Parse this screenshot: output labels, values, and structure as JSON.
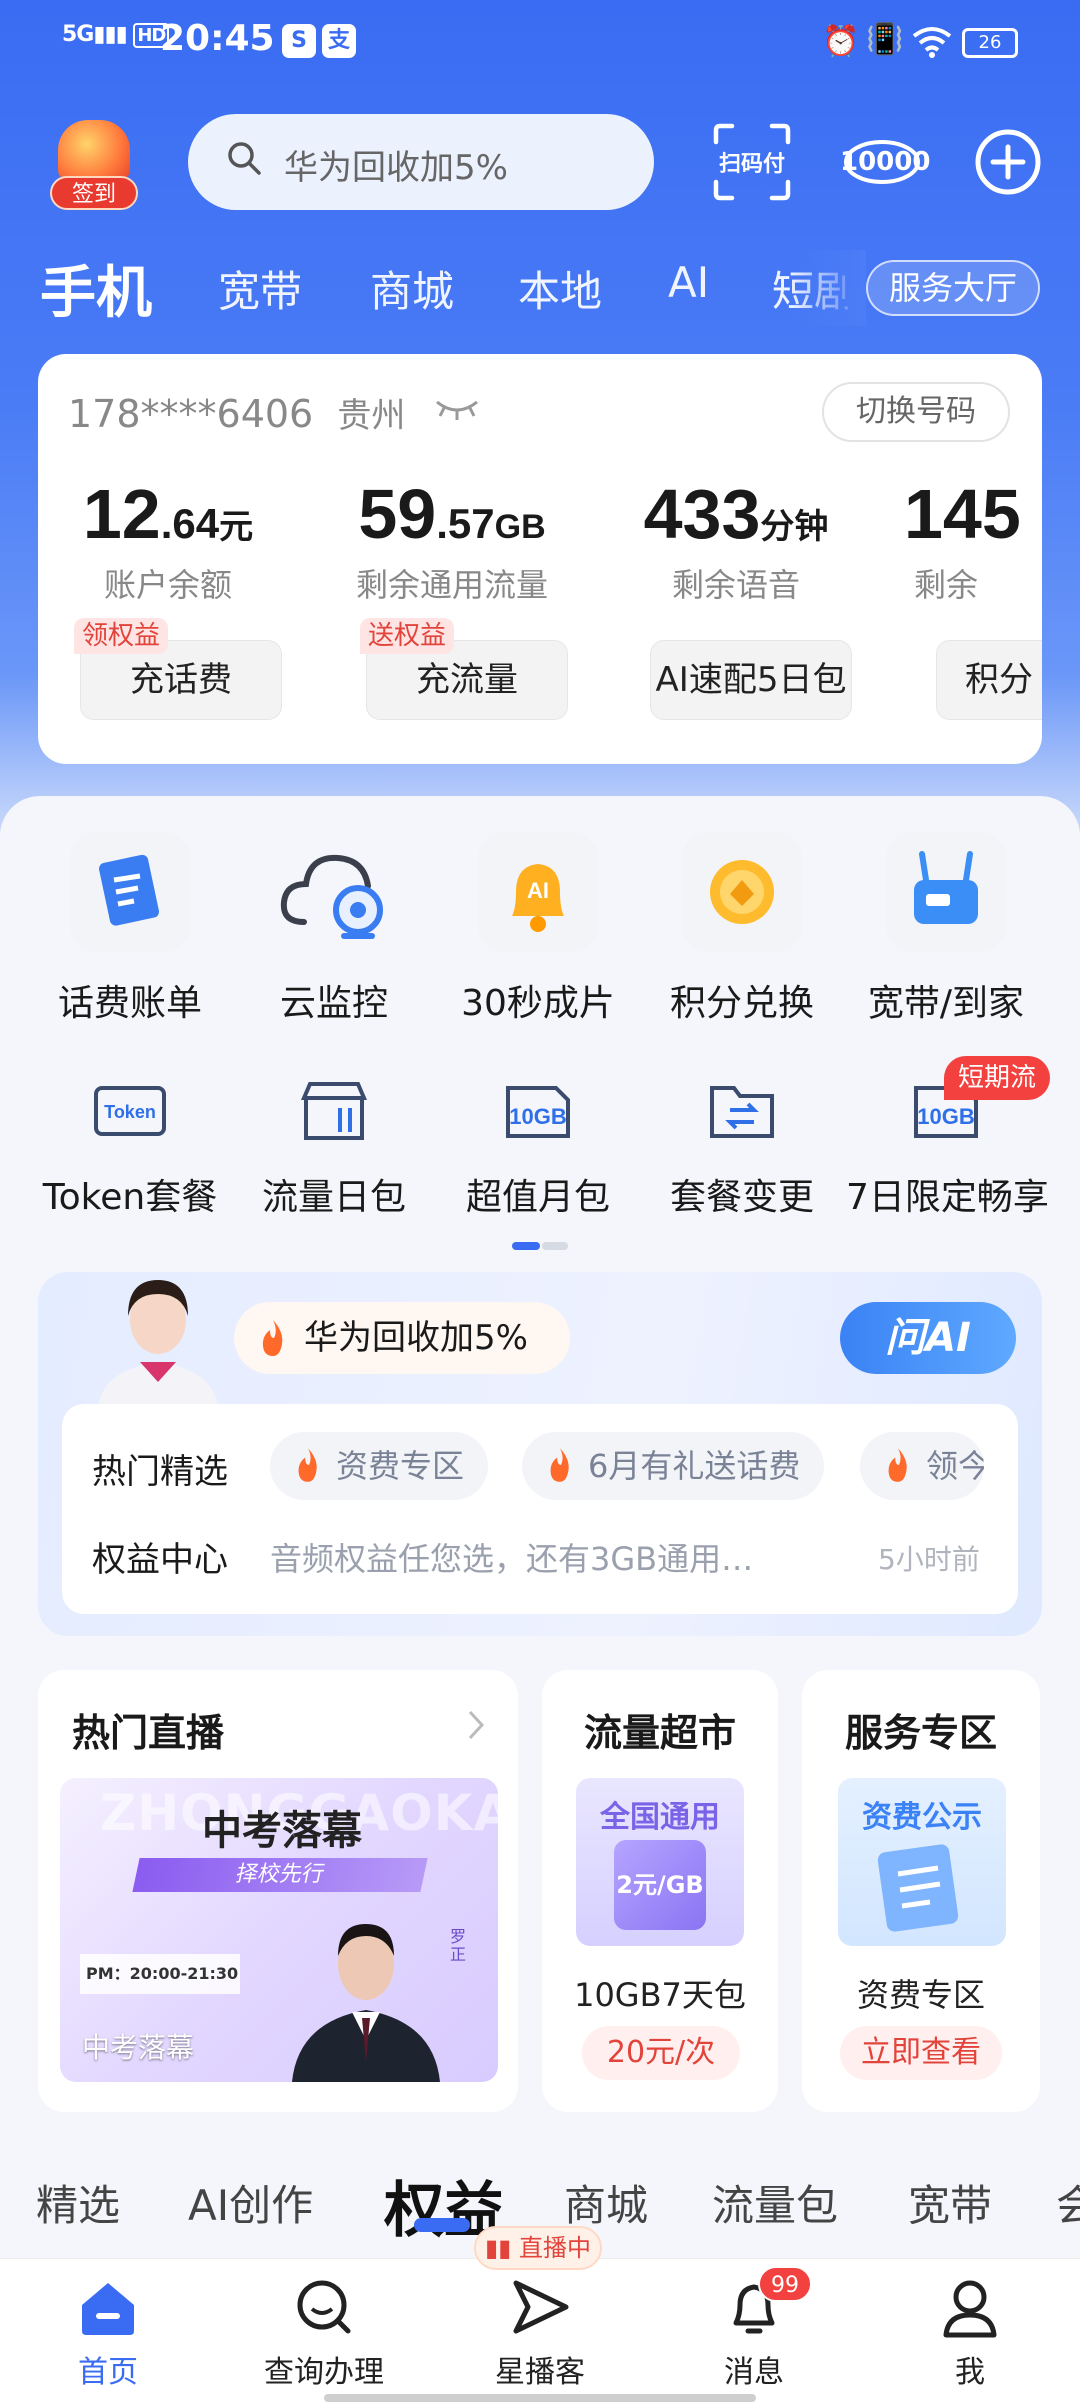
{
  "status_bar": {
    "signal": "5G",
    "hd": "HD",
    "time": "20:45",
    "battery": "26"
  },
  "header": {
    "sign_in_label": "签到",
    "search_placeholder": "华为回收加5%",
    "scan_pay_label": "扫码付",
    "hotline_label": "10000"
  },
  "top_tabs": [
    "手机",
    "宽带",
    "商城",
    "本地",
    "AI",
    "短剧"
  ],
  "service_hall": "服务大厅",
  "account": {
    "phone": "178****6406",
    "region": "贵州",
    "switch_label": "切换号码",
    "metrics": [
      {
        "int": "12",
        "dec": ".64",
        "unit": "元",
        "caption": "账户余额",
        "button": "充话费",
        "tag": "领权益"
      },
      {
        "int": "59",
        "dec": ".57",
        "unit": "GB",
        "caption": "剩余通用流量",
        "button": "充流量",
        "tag": "送权益"
      },
      {
        "int": "433",
        "dec": "",
        "unit": "分钟",
        "caption": "剩余语音",
        "button": "AI速配5日包",
        "tag": ""
      },
      {
        "int": "145",
        "dec": "",
        "unit": "",
        "caption": "剩余",
        "button": "积分",
        "tag": ""
      }
    ]
  },
  "grid_row1": [
    {
      "label": "话费账单",
      "icon": "bill-icon"
    },
    {
      "label": "云监控",
      "icon": "cloud-camera-icon"
    },
    {
      "label": "30秒成片",
      "icon": "ai-bell-icon"
    },
    {
      "label": "积分兑换",
      "icon": "points-coin-icon"
    },
    {
      "label": "宽带/到家",
      "icon": "router-icon"
    }
  ],
  "grid_row2": [
    {
      "label": "Token套餐",
      "icon": "token-icon",
      "glyph": "Token"
    },
    {
      "label": "流量日包",
      "icon": "data-daily-icon",
      "glyph": ""
    },
    {
      "label": "超值月包",
      "icon": "10gb-icon",
      "glyph": "10GB"
    },
    {
      "label": "套餐变更",
      "icon": "swap-folder-icon",
      "glyph": ""
    },
    {
      "label": "7日限定畅享",
      "icon": "10gb-icon",
      "glyph": "10GB"
    }
  ],
  "grid_badge": "短期流",
  "ai_card": {
    "promo": "华为回收加5%",
    "ask_ai": "问AI",
    "hot_label": "热门精选",
    "chips": [
      "资费专区",
      "6月有礼送话费",
      "领今"
    ],
    "rights_label": "权益中心",
    "rights_text": "音频权益任您选，还有3GB通用…",
    "rights_time": "5小时前"
  },
  "cards": {
    "live": {
      "title": "热门直播",
      "banner_bg": "ZHONGGAOKAO",
      "banner_title": "中考落幕",
      "banner_sub": "择校先行",
      "banner_date": "PM：20:00-21:30",
      "caption": "中考落幕",
      "side_tag": "罗正"
    },
    "market": {
      "title": "流量超市",
      "img_text": "全国通用",
      "img_price": "2元/GB",
      "name": "10GB7天包",
      "price": "20元/次"
    },
    "service": {
      "title": "服务专区",
      "img_text": "资费公示",
      "name": "资费专区",
      "action": "立即查看"
    }
  },
  "bottom_tabs": [
    "精选",
    "AI创作",
    "权益",
    "商城",
    "流量包",
    "宽带",
    "会"
  ],
  "tabbar": {
    "live_pill": "直播中",
    "items": [
      "首页",
      "查询办理",
      "星播客",
      "消息",
      "我"
    ],
    "msg_badge": "99"
  },
  "colors": {
    "brand_blue": "#3a6cf3",
    "accent_red": "#e2433b"
  }
}
